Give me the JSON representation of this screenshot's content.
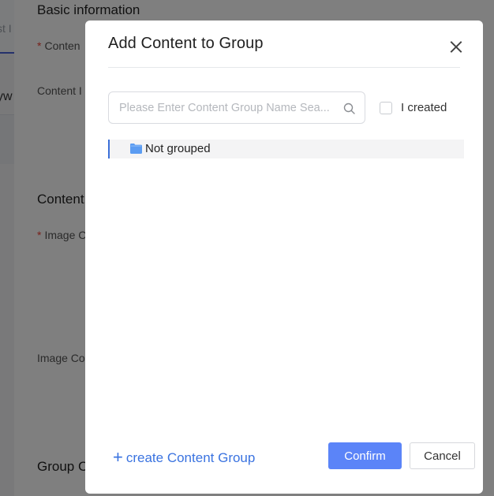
{
  "background": {
    "left_fragments": {
      "top_fragment": "st I",
      "mid_fragment": "yw"
    },
    "sections": {
      "basic_information": "Basic information",
      "content": "Content",
      "group": "Group C"
    },
    "fields": {
      "content_required": "Conten",
      "content_other": "Content I",
      "image_required": "Image C",
      "image_other": "Image Co"
    },
    "required_mark": "*"
  },
  "modal": {
    "title": "Add Content to Group",
    "close_icon": "close-icon",
    "search": {
      "placeholder": "Please Enter Content Group Name Sea...",
      "value": "",
      "icon": "search-icon"
    },
    "filter": {
      "label": "I created",
      "checked": false
    },
    "tree": [
      {
        "label": "Not grouped",
        "icon": "folder-icon",
        "selected": true
      }
    ],
    "footer": {
      "create_label": "create Content Group",
      "create_icon": "+",
      "confirm_label": "Confirm",
      "cancel_label": "Cancel"
    },
    "colors": {
      "primary": "#5b84f8",
      "link": "#3a73e0",
      "selection_bar": "#3b6fd8",
      "folder": "#5b9cf2"
    }
  }
}
